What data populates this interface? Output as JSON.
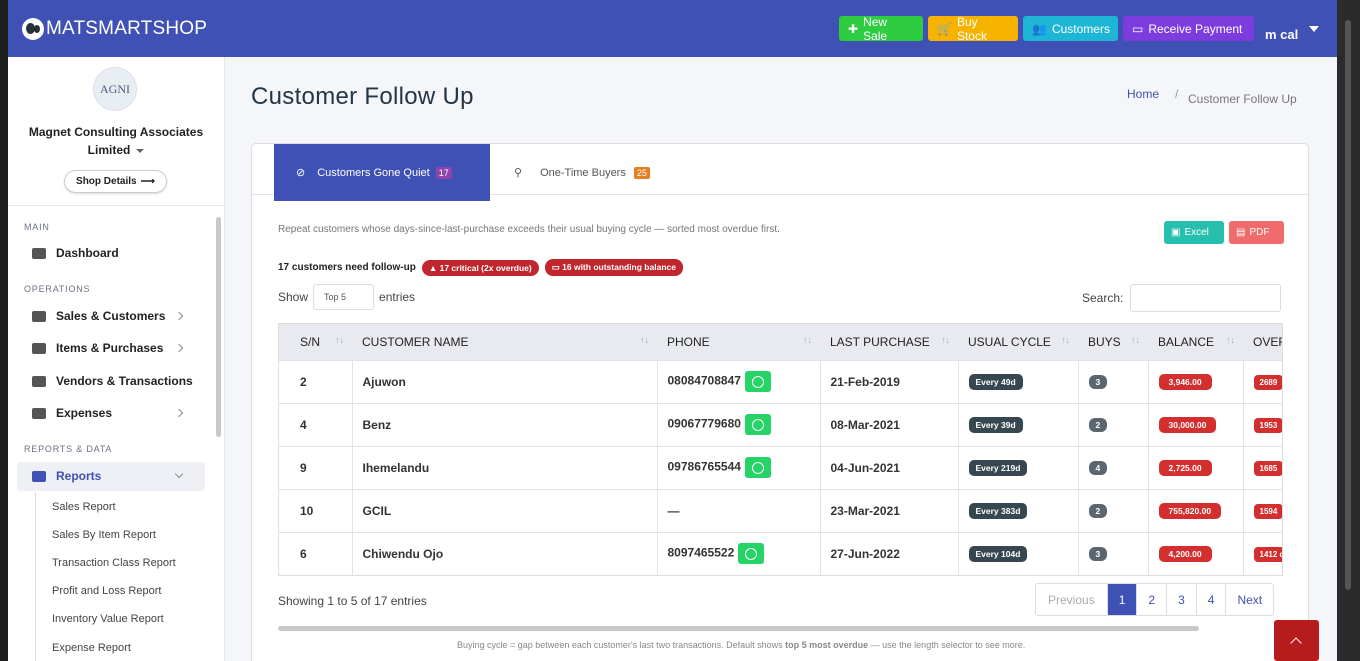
{
  "app": {
    "name": "MATSMARTSHOP",
    "user": "m cal"
  },
  "topbar": {
    "buttons": [
      {
        "label": "New Sale",
        "color": "#2ecc40"
      },
      {
        "label": "Buy Stock",
        "color": "#f5b300"
      },
      {
        "label": "Customers",
        "color": "#1fb5d5"
      },
      {
        "label": "Receive Payment",
        "color": "#7d3cde"
      }
    ]
  },
  "sidebar": {
    "org_logo_text": "AGNI",
    "org_name": "Magnet Consulting Associates Limited",
    "shop_details": "Shop Details",
    "sections": [
      "MAIN",
      "OPERATIONS",
      "REPORTS & DATA"
    ],
    "items": [
      {
        "label": "Dashboard",
        "icon": "dashboard-icon"
      },
      {
        "label": "Sales & Customers",
        "icon": "bag-icon"
      },
      {
        "label": "Items & Purchases",
        "icon": "boxes-icon"
      },
      {
        "label": "Vendors & Transactions",
        "icon": "truck-icon"
      },
      {
        "label": "Expenses",
        "icon": "card-icon"
      },
      {
        "label": "Reports",
        "icon": "chart-icon"
      }
    ],
    "report_items": [
      "Sales Report",
      "Sales By Item Report",
      "Transaction Class Report",
      "Profit and Loss Report",
      "Inventory Value Report",
      "Expense Report"
    ]
  },
  "page": {
    "title": "Customer Follow Up",
    "breadcrumb_home": "Home",
    "breadcrumb_current": "Customer Follow Up"
  },
  "tabs": [
    {
      "label": "Customers Gone Quiet",
      "count": "17"
    },
    {
      "label": "One-Time Buyers",
      "count": "25"
    }
  ],
  "description": "Repeat customers whose days-since-last-purchase exceeds their usual buying cycle — sorted most overdue first.",
  "export": {
    "excel": "Excel",
    "pdf": "PDF"
  },
  "followup": {
    "text": "17 customers need follow-up",
    "critical": "17 critical (2x overdue)",
    "balance": "16 with outstanding balance"
  },
  "controls": {
    "show": "Show",
    "entries": "entries",
    "length": "Top 5",
    "search": "Search:"
  },
  "table": {
    "headers": [
      "S/N",
      "CUSTOMER NAME",
      "PHONE",
      "LAST PURCHASE",
      "USUAL CYCLE",
      "BUYS",
      "BALANCE",
      "OVER"
    ],
    "rows": [
      {
        "sn": "2",
        "name": "Ajuwon",
        "phone": "08084708847",
        "wa": true,
        "last": "21-Feb-2019",
        "cycle": "Every 49d",
        "buys": "3",
        "balance": "3,946.00",
        "overdue": "2689"
      },
      {
        "sn": "4",
        "name": "Benz",
        "phone": "09067779680",
        "wa": true,
        "last": "08-Mar-2021",
        "cycle": "Every 39d",
        "buys": "2",
        "balance": "30,000.00",
        "overdue": "1953"
      },
      {
        "sn": "9",
        "name": "Ihemelandu",
        "phone": "09786765544",
        "wa": true,
        "last": "04-Jun-2021",
        "cycle": "Every 219d",
        "buys": "4",
        "balance": "2,725.00",
        "overdue": "1685"
      },
      {
        "sn": "10",
        "name": "GCIL",
        "phone": "—",
        "wa": false,
        "last": "23-Mar-2021",
        "cycle": "Every 383d",
        "buys": "2",
        "balance": "755,820.00",
        "overdue": "1594"
      },
      {
        "sn": "6",
        "name": "Chiwendu Ojo",
        "phone": "8097465522",
        "wa": true,
        "last": "27-Jun-2022",
        "cycle": "Every 104d",
        "buys": "3",
        "balance": "4,200.00",
        "overdue": "1412 d"
      }
    ]
  },
  "pagination": {
    "info": "Showing 1 to 5 of 17 entries",
    "previous": "Previous",
    "pages": [
      "1",
      "2",
      "3",
      "4"
    ],
    "next": "Next"
  },
  "footnote": {
    "pre": "Buying cycle = gap between each customer's last two transactions. Default shows ",
    "bold": "top 5 most overdue",
    "post": " — use the length selector to see more."
  }
}
